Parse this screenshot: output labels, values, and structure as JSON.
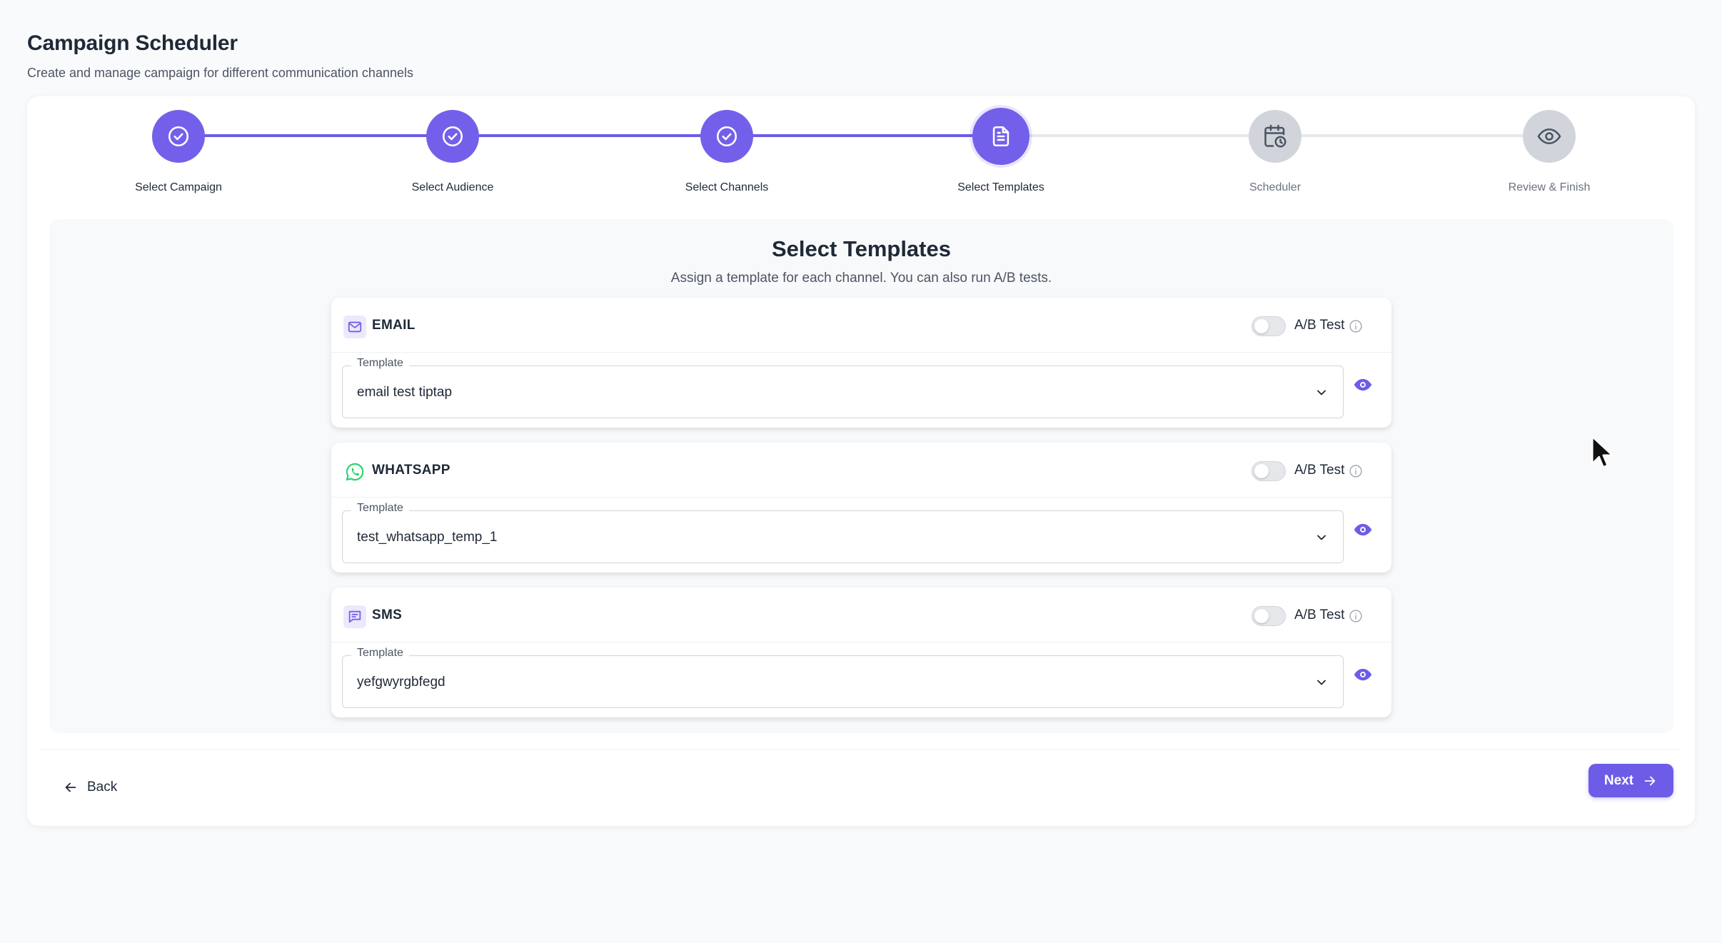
{
  "header": {
    "title": "Campaign Scheduler",
    "subtitle": "Create and manage campaign for different communication channels"
  },
  "stepper": {
    "steps": [
      {
        "label": "Select Campaign",
        "status": "completed",
        "icon": "check-icon"
      },
      {
        "label": "Select Audience",
        "status": "completed",
        "icon": "check-icon"
      },
      {
        "label": "Select Channels",
        "status": "completed",
        "icon": "check-icon"
      },
      {
        "label": "Select Templates",
        "status": "active",
        "icon": "document-icon"
      },
      {
        "label": "Scheduler",
        "status": "pending",
        "icon": "calendar-clock-icon"
      },
      {
        "label": "Review & Finish",
        "status": "pending",
        "icon": "eye-icon"
      }
    ]
  },
  "panel": {
    "title": "Select Templates",
    "subtitle": "Assign a template for each channel. You can also run A/B tests."
  },
  "channels": [
    {
      "name": "EMAIL",
      "icon": "mail-icon",
      "ab_label": "A/B Test",
      "ab_enabled": false,
      "template_label": "Template",
      "template_value": "email test tiptap"
    },
    {
      "name": "WHATSAPP",
      "icon": "whatsapp-icon",
      "ab_label": "A/B Test",
      "ab_enabled": false,
      "template_label": "Template",
      "template_value": "test_whatsapp_temp_1"
    },
    {
      "name": "SMS",
      "icon": "message-icon",
      "ab_label": "A/B Test",
      "ab_enabled": false,
      "template_label": "Template",
      "template_value": "yefgwyrgbfegd"
    }
  ],
  "footer": {
    "back_label": "Back",
    "next_label": "Next"
  },
  "colors": {
    "accent": "#6d5ce8",
    "pending": "#d1d5db",
    "whatsapp": "#25d366",
    "background": "#f9fafb"
  }
}
